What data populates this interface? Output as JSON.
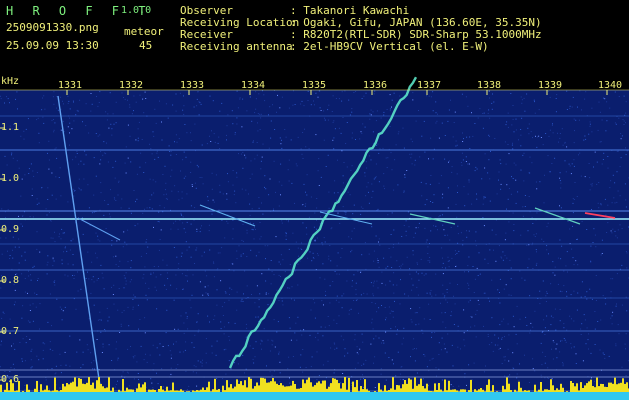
{
  "header": {
    "brand": "H R O F F T",
    "version": "1.0.0",
    "filename": "2509091330.png",
    "datetime": "25.09.09 13:30",
    "meteor_label": "meteor",
    "meteor_count": "45",
    "info": [
      {
        "key": "Observer",
        "value": ": Takanori Kawachi"
      },
      {
        "key": "Receiving Location",
        "value": ": Ogaki, Gifu, JAPAN (136.60E, 35.35N)"
      },
      {
        "key": "Receiver",
        "value": ": R820T2(RTL-SDR) SDR-Sharp 53.1000MHz"
      },
      {
        "key": "Receiving antenna",
        "value": ": 2el-HB9CV Vertical (el. E-W)"
      }
    ]
  },
  "spectrogram": {
    "y_unit": "kHz",
    "y_ticks": [
      "1.1",
      "1.0",
      "0.9",
      "0.8",
      "0.7",
      "0.6"
    ],
    "x_ticks": [
      "1331",
      "1332",
      "1333",
      "1334",
      "1335",
      "1336",
      "1337",
      "1338",
      "1339",
      "1340"
    ],
    "colors": {
      "background": "#0a1e6e",
      "noise": "#2a55c8",
      "carrier": "#a0f0ff",
      "trace": "#60f0d0",
      "baseline_bars": "#f0e020"
    }
  }
}
